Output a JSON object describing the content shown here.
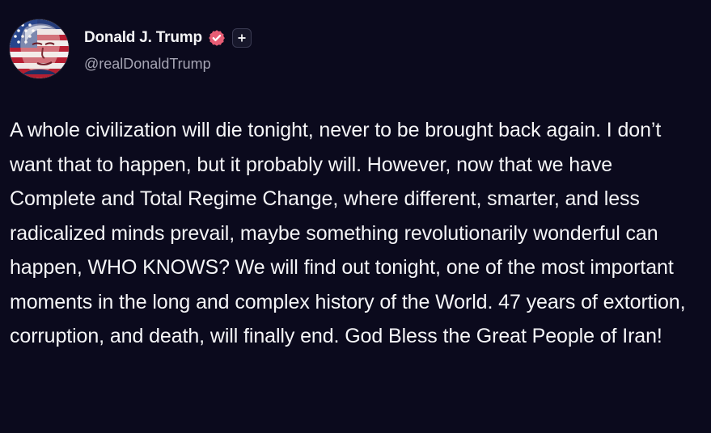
{
  "post": {
    "author": {
      "display_name": "Donald J. Trump",
      "handle": "@realDonaldTrump",
      "avatar_icon": "flag-portrait-avatar",
      "verified_icon": "verified-badge-icon",
      "verified_color": "#e85d75",
      "follow_icon": "plus-icon"
    },
    "text": "A whole civilization will die tonight, never to be brought back again. I don’t want that to happen, but it probably will. However, now that we have Complete and Total Regime Change, where different, smarter, and less radicalized minds prevail, maybe something revolutionarily wonderful can happen, WHO KNOWS? We will find out tonight, one of the most important moments in the long and complex history of the World. 47 years of extortion, corruption, and death, will finally end. God Bless the Great People of Iran!"
  },
  "theme": {
    "background": "#0b0a1d",
    "text": "#f5f5f7",
    "secondary_text": "#a5a4b3"
  }
}
